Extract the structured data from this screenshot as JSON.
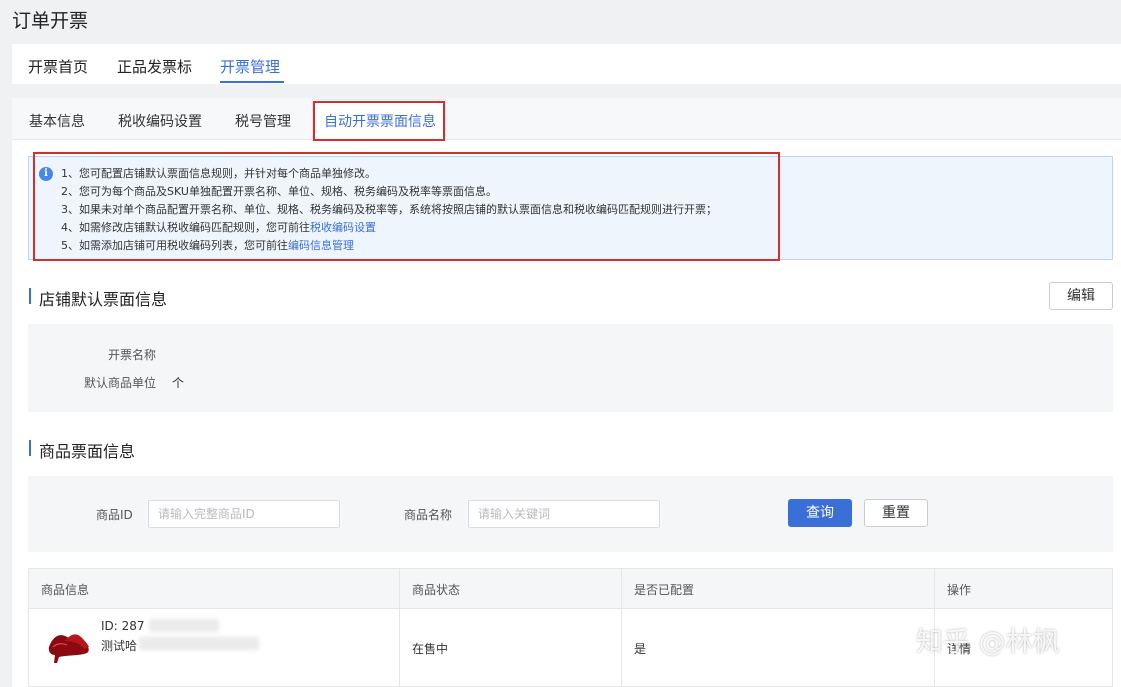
{
  "page_title": "订单开票",
  "main_tabs": [
    {
      "label": "开票首页"
    },
    {
      "label": "正品发票标"
    },
    {
      "label": "开票管理"
    }
  ],
  "sub_tabs": [
    {
      "label": "基本信息"
    },
    {
      "label": "税收编码设置"
    },
    {
      "label": "税号管理"
    },
    {
      "label": "自动开票票面信息"
    }
  ],
  "info": {
    "lines": [
      "1、您可配置店铺默认票面信息规则，并针对每个商品单独修改。",
      "2、您可为每个商品及SKU单独配置开票名称、单位、规格、税务编码及税率等票面信息。",
      "3、如果未对单个商品配置开票名称、单位、规格、税务编码及税率等，系统将按照店铺的默认票面信息和税收编码匹配规则进行开票；"
    ],
    "line4_prefix": "4、如需修改店铺默认税收编码匹配规则，您可前往",
    "line4_link": "税收编码设置",
    "line5_prefix": "5、如需添加店铺可用税收编码列表，您可前往",
    "line5_link": "编码信息管理"
  },
  "store_section": {
    "title": "店铺默认票面信息",
    "edit_label": "编辑",
    "fields": [
      {
        "label": "开票名称",
        "value": ""
      },
      {
        "label": "默认商品单位",
        "value": "个"
      }
    ]
  },
  "product_section": {
    "title": "商品票面信息",
    "filter": {
      "id_label": "商品ID",
      "id_placeholder": "请输入完整商品ID",
      "name_label": "商品名称",
      "name_placeholder": "请输入关键词",
      "query_label": "查询",
      "reset_label": "重置"
    },
    "table": {
      "headers": [
        "商品信息",
        "商品状态",
        "是否已配置",
        "操作"
      ],
      "rows": [
        {
          "id": "ID: 287",
          "name": "测试哈",
          "status": "在售中",
          "configured": "是",
          "action": "详情"
        }
      ]
    }
  },
  "watermark": "知乎 @林枫",
  "colors": {
    "accent": "#3b6fd8",
    "highlight_border": "#d32f2f",
    "info_bg": "#eef5fd"
  }
}
